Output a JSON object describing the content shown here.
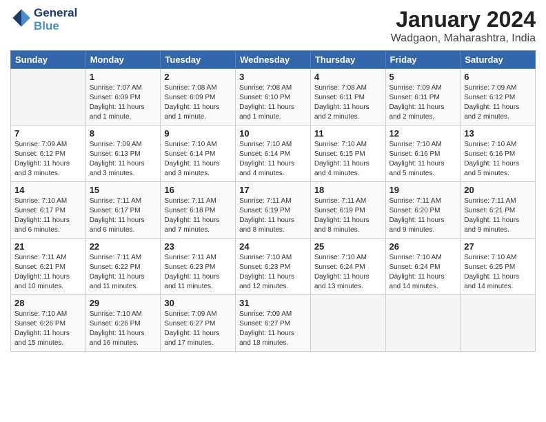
{
  "header": {
    "logo_line1": "General",
    "logo_line2": "Blue",
    "month": "January 2024",
    "location": "Wadgaon, Maharashtra, India"
  },
  "weekdays": [
    "Sunday",
    "Monday",
    "Tuesday",
    "Wednesday",
    "Thursday",
    "Friday",
    "Saturday"
  ],
  "weeks": [
    [
      {
        "date": "",
        "info": ""
      },
      {
        "date": "1",
        "info": "Sunrise: 7:07 AM\nSunset: 6:09 PM\nDaylight: 11 hours\nand 1 minute."
      },
      {
        "date": "2",
        "info": "Sunrise: 7:08 AM\nSunset: 6:09 PM\nDaylight: 11 hours\nand 1 minute."
      },
      {
        "date": "3",
        "info": "Sunrise: 7:08 AM\nSunset: 6:10 PM\nDaylight: 11 hours\nand 1 minute."
      },
      {
        "date": "4",
        "info": "Sunrise: 7:08 AM\nSunset: 6:11 PM\nDaylight: 11 hours\nand 2 minutes."
      },
      {
        "date": "5",
        "info": "Sunrise: 7:09 AM\nSunset: 6:11 PM\nDaylight: 11 hours\nand 2 minutes."
      },
      {
        "date": "6",
        "info": "Sunrise: 7:09 AM\nSunset: 6:12 PM\nDaylight: 11 hours\nand 2 minutes."
      }
    ],
    [
      {
        "date": "7",
        "info": "Sunrise: 7:09 AM\nSunset: 6:12 PM\nDaylight: 11 hours\nand 3 minutes."
      },
      {
        "date": "8",
        "info": "Sunrise: 7:09 AM\nSunset: 6:13 PM\nDaylight: 11 hours\nand 3 minutes."
      },
      {
        "date": "9",
        "info": "Sunrise: 7:10 AM\nSunset: 6:14 PM\nDaylight: 11 hours\nand 3 minutes."
      },
      {
        "date": "10",
        "info": "Sunrise: 7:10 AM\nSunset: 6:14 PM\nDaylight: 11 hours\nand 4 minutes."
      },
      {
        "date": "11",
        "info": "Sunrise: 7:10 AM\nSunset: 6:15 PM\nDaylight: 11 hours\nand 4 minutes."
      },
      {
        "date": "12",
        "info": "Sunrise: 7:10 AM\nSunset: 6:16 PM\nDaylight: 11 hours\nand 5 minutes."
      },
      {
        "date": "13",
        "info": "Sunrise: 7:10 AM\nSunset: 6:16 PM\nDaylight: 11 hours\nand 5 minutes."
      }
    ],
    [
      {
        "date": "14",
        "info": "Sunrise: 7:10 AM\nSunset: 6:17 PM\nDaylight: 11 hours\nand 6 minutes."
      },
      {
        "date": "15",
        "info": "Sunrise: 7:11 AM\nSunset: 6:17 PM\nDaylight: 11 hours\nand 6 minutes."
      },
      {
        "date": "16",
        "info": "Sunrise: 7:11 AM\nSunset: 6:18 PM\nDaylight: 11 hours\nand 7 minutes."
      },
      {
        "date": "17",
        "info": "Sunrise: 7:11 AM\nSunset: 6:19 PM\nDaylight: 11 hours\nand 8 minutes."
      },
      {
        "date": "18",
        "info": "Sunrise: 7:11 AM\nSunset: 6:19 PM\nDaylight: 11 hours\nand 8 minutes."
      },
      {
        "date": "19",
        "info": "Sunrise: 7:11 AM\nSunset: 6:20 PM\nDaylight: 11 hours\nand 9 minutes."
      },
      {
        "date": "20",
        "info": "Sunrise: 7:11 AM\nSunset: 6:21 PM\nDaylight: 11 hours\nand 9 minutes."
      }
    ],
    [
      {
        "date": "21",
        "info": "Sunrise: 7:11 AM\nSunset: 6:21 PM\nDaylight: 11 hours\nand 10 minutes."
      },
      {
        "date": "22",
        "info": "Sunrise: 7:11 AM\nSunset: 6:22 PM\nDaylight: 11 hours\nand 11 minutes."
      },
      {
        "date": "23",
        "info": "Sunrise: 7:11 AM\nSunset: 6:23 PM\nDaylight: 11 hours\nand 11 minutes."
      },
      {
        "date": "24",
        "info": "Sunrise: 7:10 AM\nSunset: 6:23 PM\nDaylight: 11 hours\nand 12 minutes."
      },
      {
        "date": "25",
        "info": "Sunrise: 7:10 AM\nSunset: 6:24 PM\nDaylight: 11 hours\nand 13 minutes."
      },
      {
        "date": "26",
        "info": "Sunrise: 7:10 AM\nSunset: 6:24 PM\nDaylight: 11 hours\nand 14 minutes."
      },
      {
        "date": "27",
        "info": "Sunrise: 7:10 AM\nSunset: 6:25 PM\nDaylight: 11 hours\nand 14 minutes."
      }
    ],
    [
      {
        "date": "28",
        "info": "Sunrise: 7:10 AM\nSunset: 6:26 PM\nDaylight: 11 hours\nand 15 minutes."
      },
      {
        "date": "29",
        "info": "Sunrise: 7:10 AM\nSunset: 6:26 PM\nDaylight: 11 hours\nand 16 minutes."
      },
      {
        "date": "30",
        "info": "Sunrise: 7:09 AM\nSunset: 6:27 PM\nDaylight: 11 hours\nand 17 minutes."
      },
      {
        "date": "31",
        "info": "Sunrise: 7:09 AM\nSunset: 6:27 PM\nDaylight: 11 hours\nand 18 minutes."
      },
      {
        "date": "",
        "info": ""
      },
      {
        "date": "",
        "info": ""
      },
      {
        "date": "",
        "info": ""
      }
    ]
  ]
}
